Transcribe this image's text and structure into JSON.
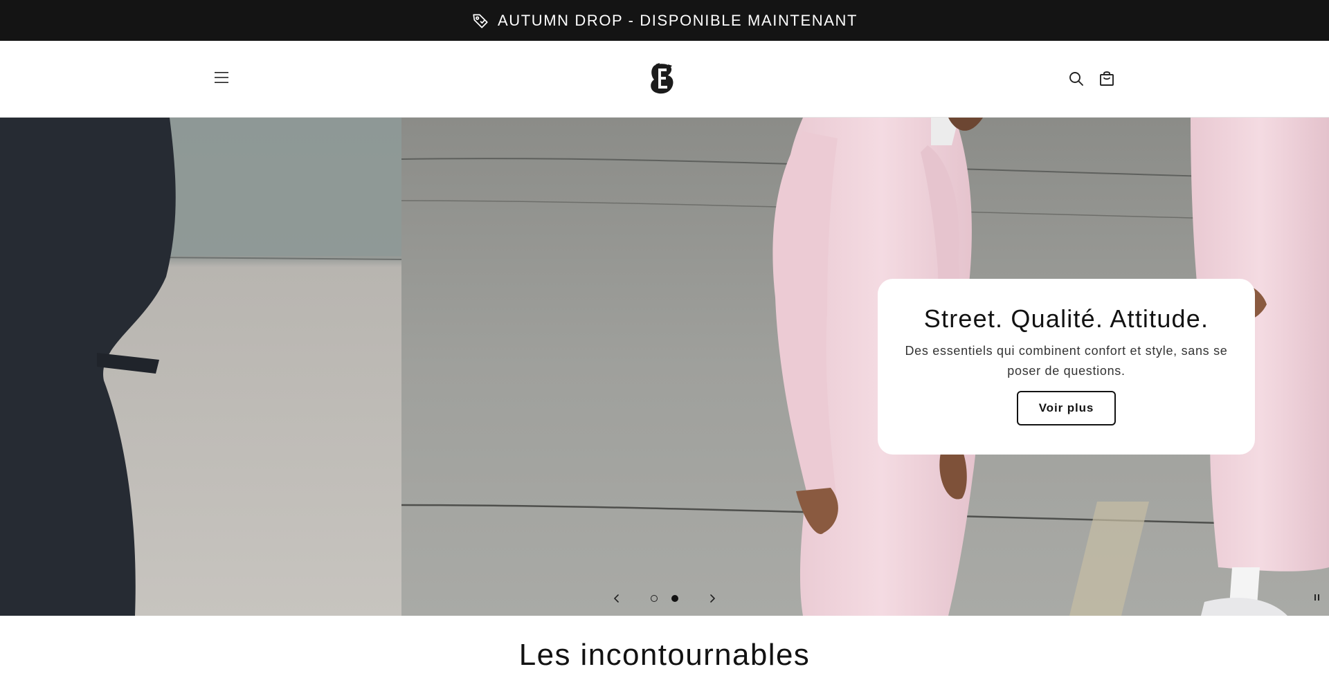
{
  "announcement": {
    "text": "AUTUMN DROP - DISPONIBLE MAINTENANT",
    "icon": "tag-icon"
  },
  "header": {
    "menu_icon": "hamburger-menu-icon",
    "logo_icon": "brand-logo",
    "search_icon": "search-icon",
    "cart_icon": "shopping-bag-icon"
  },
  "hero": {
    "heading": "Street. Qualité. Attitude.",
    "subtext": "Des essentiels qui combinent confort et style, sans se poser de questions.",
    "button_label": "Voir plus",
    "slides_total": 2,
    "active_slide": 2
  },
  "section": {
    "title": "Les incontournables"
  },
  "colors": {
    "announcement_bg": "#141414",
    "text": "#121212",
    "card_bg": "#ffffff",
    "hoodie_pink": "#f2d7df"
  }
}
